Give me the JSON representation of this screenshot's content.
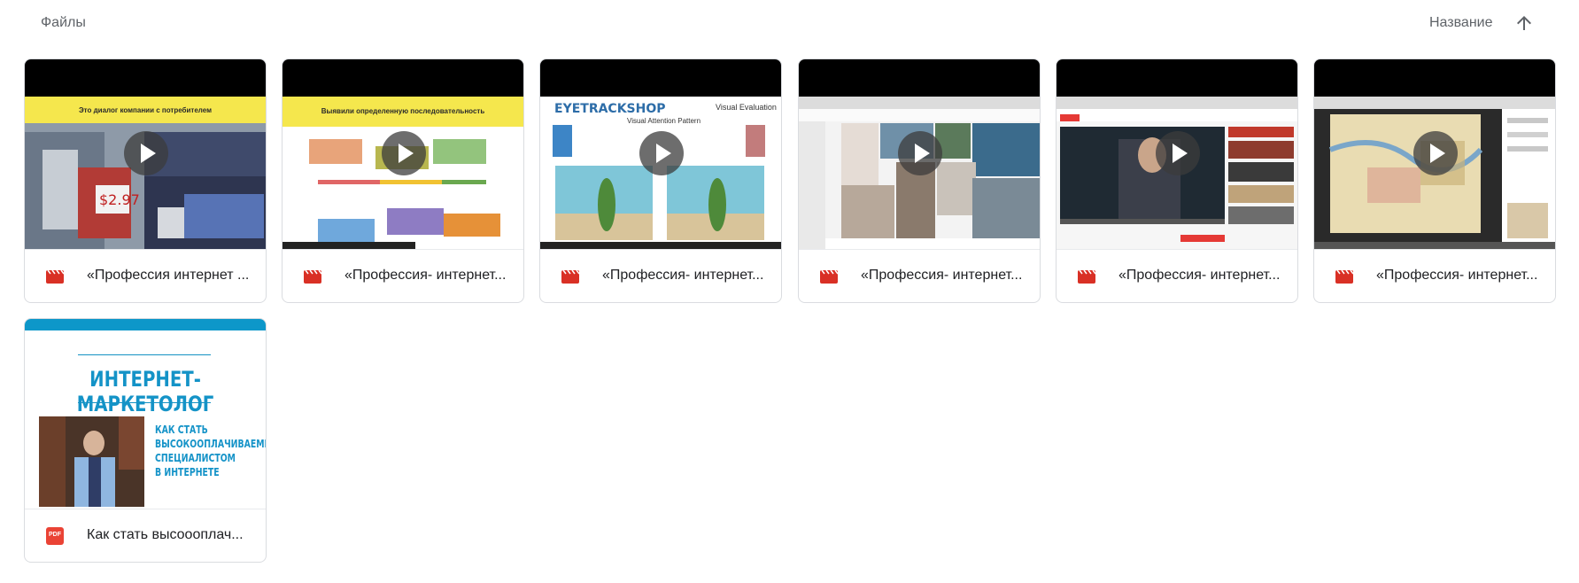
{
  "header": {
    "title": "Файлы",
    "sort_label": "Название",
    "sort_icon": "arrow-upward-icon"
  },
  "files": [
    {
      "name": "«Профессия интернет ...",
      "type": "video",
      "icon": "video-file-icon",
      "thumb_caption": "Это диалог компании с потребителем"
    },
    {
      "name": "«Профессия- интернет...",
      "type": "video",
      "icon": "video-file-icon",
      "thumb_caption": "Выявили определенную последовательность"
    },
    {
      "name": "«Профессия- интернет...",
      "type": "video",
      "icon": "video-file-icon",
      "thumb_caption": "EYETRACKSHOP",
      "thumb_caption2": "Visual Evaluation",
      "thumb_caption3": "Visual Attention Pattern"
    },
    {
      "name": "«Профессия- интернет...",
      "type": "video",
      "icon": "video-file-icon"
    },
    {
      "name": "«Профессия- интернет...",
      "type": "video",
      "icon": "video-file-icon"
    },
    {
      "name": "«Профессия- интернет...",
      "type": "video",
      "icon": "video-file-icon"
    },
    {
      "name": "Как стать высоооплач...",
      "type": "pdf",
      "icon": "pdf-file-icon",
      "badge": "PDF",
      "cover_title": "ИНТЕРНЕТ-МАРКЕТОЛОГ",
      "cover_subtitle": [
        "КАК СТАТЬ",
        "ВЫСОКООПЛАЧИВАЕМЫМ",
        "СПЕЦИАЛИСТОМ",
        "В ИНТЕРНЕТЕ"
      ]
    }
  ],
  "colors": {
    "video_icon": "#d93025",
    "pdf_icon": "#ea4335",
    "pdf_accent": "#1493c7"
  }
}
